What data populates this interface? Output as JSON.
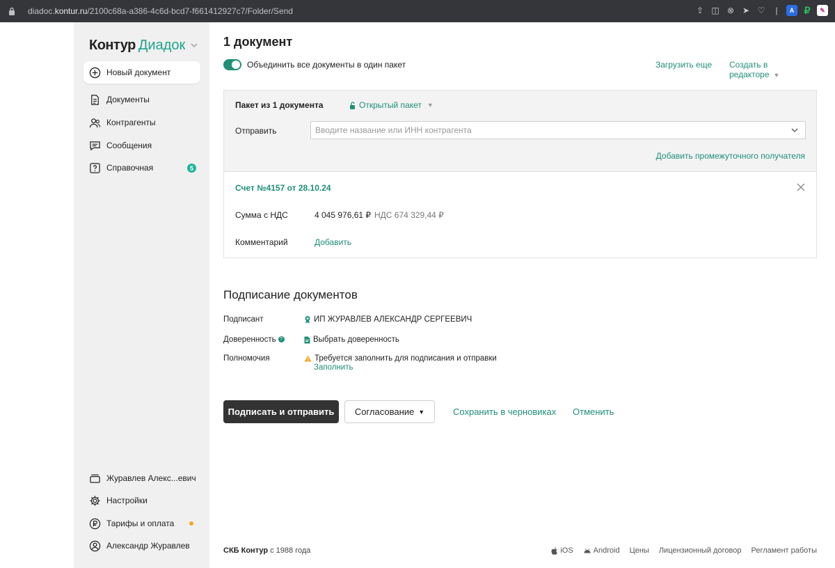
{
  "browser": {
    "url_host": "diadoc.",
    "url_domain": "kontur.ru",
    "url_path": "/2100c68a-a386-4c6d-bcd7-f661412927c7/Folder/Send"
  },
  "sidebar": {
    "logo_part1": "Контур",
    "logo_part2": "Диадок",
    "new_document": "Новый документ",
    "items": [
      {
        "label": "Документы"
      },
      {
        "label": "Контрагенты"
      },
      {
        "label": "Сообщения"
      },
      {
        "label": "Справочная",
        "badge": "5"
      }
    ],
    "bottom_items": [
      {
        "label": "Журавлев Алекс...евич"
      },
      {
        "label": "Настройки"
      },
      {
        "label": "Тарифы и оплата"
      },
      {
        "label": "Александр Журавлев"
      }
    ]
  },
  "main": {
    "title": "1 документ",
    "merge_toggle_label": "Объединить все документы в один пакет",
    "merge_toggle_on": true,
    "upload_more": "Загрузить еще",
    "create_in_editor": "Создать в редакторе",
    "package": {
      "title": "Пакет из 1 документа",
      "type": "Открытый пакет",
      "send_label": "Отправить",
      "send_placeholder": "Вводите название или ИНН контрагента",
      "add_intermediate": "Добавить промежуточного получателя"
    },
    "document": {
      "title": "Счет №4157 от 28.10.24",
      "sum_label": "Сумма с НДС",
      "sum_value": "4 045 976,61 ₽",
      "vat_value": "НДС 674 329,44 ₽",
      "comment_label": "Комментарий",
      "comment_add": "Добавить"
    },
    "signing": {
      "title": "Подписание документов",
      "signer_label": "Подписант",
      "signer_value": "ИП ЖУРАВЛЕВ АЛЕКСАНДР СЕРГЕЕВИЧ",
      "poa_label": "Доверенность",
      "poa_value": "Выбрать доверенность",
      "authority_label": "Полномочия",
      "authority_warning": "Требуется заполнить для подписания и отправки",
      "authority_fill": "Заполнить"
    },
    "actions": {
      "sign_send": "Подписать и отправить",
      "approval": "Согласование",
      "save_draft": "Сохранить в черновиках",
      "cancel": "Отменить"
    }
  },
  "footer": {
    "company": "СКБ Контур",
    "since": " с 1988 года",
    "links": [
      "iOS",
      "Android",
      "Цены",
      "Лицензионный договор",
      "Регламент работы"
    ]
  },
  "colors": {
    "accent": "#1f8f77",
    "brand_green": "#1fa38a",
    "primary_button": "#333333",
    "badge": "#1fb597",
    "warning": "#f5a623"
  }
}
